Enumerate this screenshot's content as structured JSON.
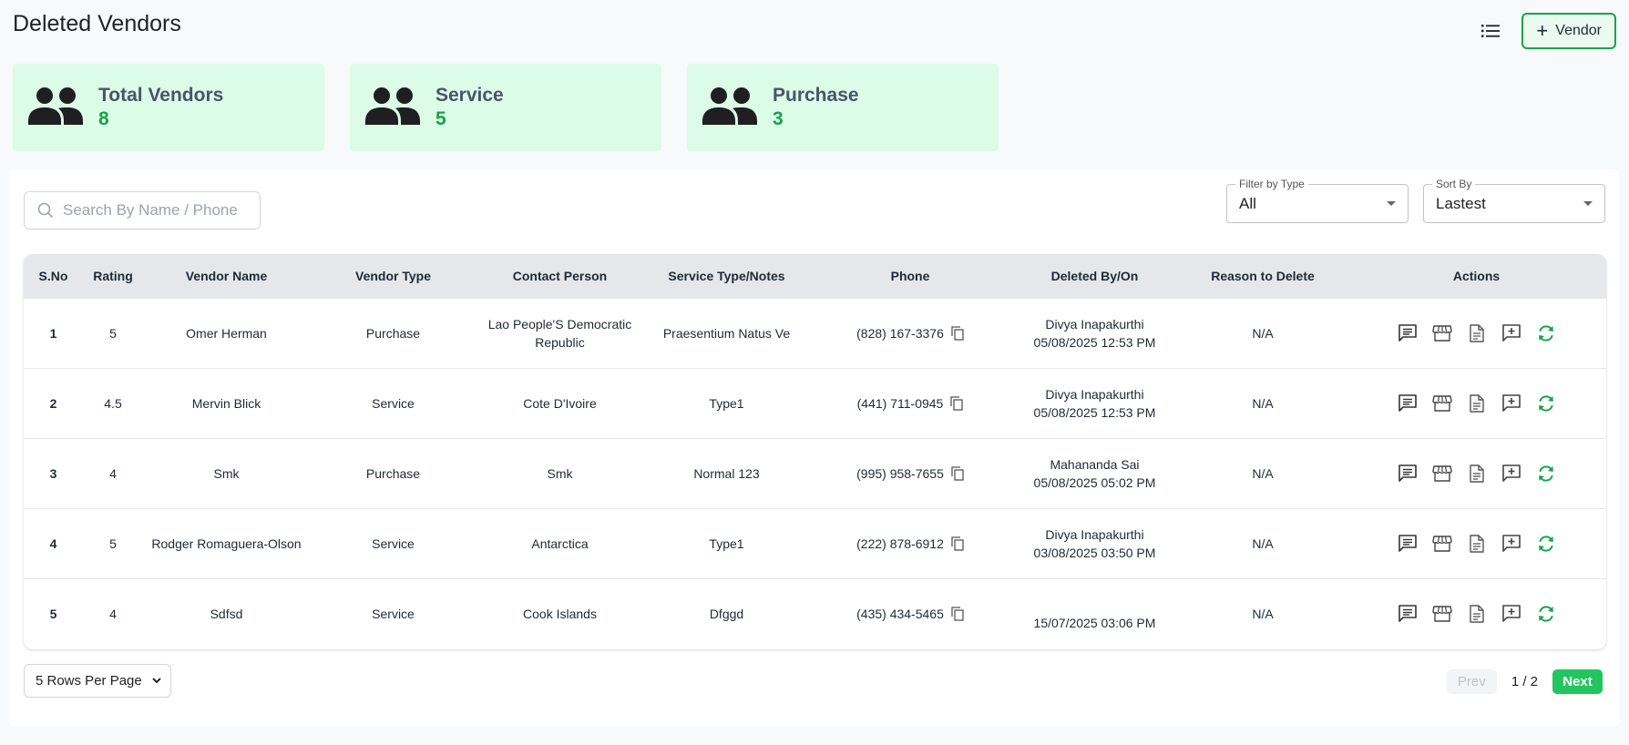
{
  "page": {
    "title": "Deleted Vendors"
  },
  "header": {
    "add_vendor_label": "Vendor"
  },
  "stats": [
    {
      "label": "Total Vendors",
      "value": "8"
    },
    {
      "label": "Service",
      "value": "5"
    },
    {
      "label": "Purchase",
      "value": "3"
    }
  ],
  "search": {
    "placeholder": "Search By Name / Phone",
    "value": ""
  },
  "filter": {
    "label": "Filter by Type",
    "value": "All"
  },
  "sort": {
    "label": "Sort By",
    "value": "Lastest"
  },
  "table": {
    "columns": [
      "S.No",
      "Rating",
      "Vendor Name",
      "Vendor Type",
      "Contact Person",
      "Service Type/Notes",
      "Phone",
      "Deleted By/On",
      "Reason to Delete",
      "Actions"
    ],
    "rows": [
      {
        "sno": "1",
        "rating": "5",
        "vendor_name": "Omer Herman",
        "vendor_type": "Purchase",
        "contact_person": "Lao People'S Democratic Republic",
        "service_notes": "Praesentium Natus Ve",
        "phone": "(828) 167-3376",
        "deleted_by": "Divya Inapakurthi",
        "deleted_on": "05/08/2025 12:53 PM",
        "reason": "N/A"
      },
      {
        "sno": "2",
        "rating": "4.5",
        "vendor_name": "Mervin Blick",
        "vendor_type": "Service",
        "contact_person": "Cote D'Ivoire",
        "service_notes": "Type1",
        "phone": "(441) 711-0945",
        "deleted_by": "Divya Inapakurthi",
        "deleted_on": "05/08/2025 12:53 PM",
        "reason": "N/A"
      },
      {
        "sno": "3",
        "rating": "4",
        "vendor_name": "Smk",
        "vendor_type": "Purchase",
        "contact_person": "Smk",
        "service_notes": "Normal 123",
        "phone": "(995) 958-7655",
        "deleted_by": "Mahananda Sai",
        "deleted_on": "05/08/2025 05:02 PM",
        "reason": "N/A"
      },
      {
        "sno": "4",
        "rating": "5",
        "vendor_name": "Rodger Romaguera-Olson",
        "vendor_type": "Service",
        "contact_person": "Antarctica",
        "service_notes": "Type1",
        "phone": "(222) 878-6912",
        "deleted_by": "Divya Inapakurthi",
        "deleted_on": "03/08/2025 03:50 PM",
        "reason": "N/A"
      },
      {
        "sno": "5",
        "rating": "4",
        "vendor_name": "Sdfsd",
        "vendor_type": "Service",
        "contact_person": "Cook Islands",
        "service_notes": "Dfggd",
        "phone": "(435) 434-5465",
        "deleted_by": "",
        "deleted_on": "15/07/2025 03:06 PM",
        "reason": "N/A"
      }
    ]
  },
  "pagination": {
    "rows_per_page": "5 Rows Per Page",
    "prev_label": "Prev",
    "page_indicator": "1 / 2",
    "next_label": "Next"
  },
  "colors": {
    "accent": "#22c55e",
    "card_bg": "#dcfce7",
    "stat_value": "#16a34a",
    "refresh_icon": "#16a34a"
  }
}
